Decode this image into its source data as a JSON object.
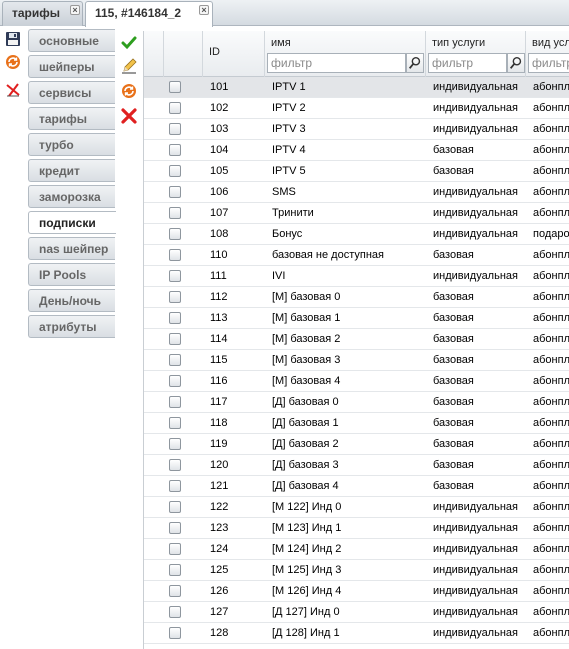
{
  "tabs": [
    {
      "label": "тарифы"
    },
    {
      "label": "115, #146184_2"
    }
  ],
  "subtabs": [
    {
      "label": "основные"
    },
    {
      "label": "шейперы"
    },
    {
      "label": "сервисы"
    },
    {
      "label": "тарифы"
    },
    {
      "label": "турбо"
    },
    {
      "label": "кредит"
    },
    {
      "label": "заморозка"
    },
    {
      "label": "подписки"
    },
    {
      "label": "nas шейпер"
    },
    {
      "label": "IP Pools"
    },
    {
      "label": "День/ночь"
    },
    {
      "label": "атрибуты"
    }
  ],
  "active_subtab": "подписки",
  "grid": {
    "columns": {
      "id": "ID",
      "name": "имя",
      "type": "тип услуги",
      "kind": "вид услу"
    },
    "filter_placeholder": "фильтр",
    "rows": [
      {
        "id": "101",
        "name": "IPTV 1",
        "type": "индивидуальная",
        "kind": "абонпл"
      },
      {
        "id": "102",
        "name": "IPTV 2",
        "type": "индивидуальная",
        "kind": "абонпл"
      },
      {
        "id": "103",
        "name": "IPTV 3",
        "type": "индивидуальная",
        "kind": "абонпл"
      },
      {
        "id": "104",
        "name": "IPTV 4",
        "type": "базовая",
        "kind": "абонпл"
      },
      {
        "id": "105",
        "name": "IPTV 5",
        "type": "базовая",
        "kind": "абонпл"
      },
      {
        "id": "106",
        "name": "SMS",
        "type": "индивидуальная",
        "kind": "абонпл"
      },
      {
        "id": "107",
        "name": "Тринити",
        "type": "индивидуальная",
        "kind": "абонпл"
      },
      {
        "id": "108",
        "name": "Бонус",
        "type": "индивидуальная",
        "kind": "подаро"
      },
      {
        "id": "110",
        "name": "базовая не доступная",
        "type": "базовая",
        "kind": "абонпл"
      },
      {
        "id": "111",
        "name": "IVI",
        "type": "индивидуальная",
        "kind": "абонпл"
      },
      {
        "id": "112",
        "name": "[M] базовая 0",
        "type": "базовая",
        "kind": "абонпл"
      },
      {
        "id": "113",
        "name": "[M] базовая 1",
        "type": "базовая",
        "kind": "абонпл"
      },
      {
        "id": "114",
        "name": "[M] базовая 2",
        "type": "базовая",
        "kind": "абонпл"
      },
      {
        "id": "115",
        "name": "[M] базовая 3",
        "type": "базовая",
        "kind": "абонпл"
      },
      {
        "id": "116",
        "name": "[M] базовая 4",
        "type": "базовая",
        "kind": "абонпл"
      },
      {
        "id": "117",
        "name": "[Д] базовая 0",
        "type": "базовая",
        "kind": "абонпл"
      },
      {
        "id": "118",
        "name": "[Д] базовая 1",
        "type": "базовая",
        "kind": "абонпл"
      },
      {
        "id": "119",
        "name": "[Д] базовая 2",
        "type": "базовая",
        "kind": "абонпл"
      },
      {
        "id": "120",
        "name": "[Д] базовая 3",
        "type": "базовая",
        "kind": "абонпл"
      },
      {
        "id": "121",
        "name": "[Д] базовая 4",
        "type": "базовая",
        "kind": "абонпл"
      },
      {
        "id": "122",
        "name": "[M 122] Инд 0",
        "type": "индивидуальная",
        "kind": "абонпл"
      },
      {
        "id": "123",
        "name": "[M 123] Инд 1",
        "type": "индивидуальная",
        "kind": "абонпл"
      },
      {
        "id": "124",
        "name": "[M 124] Инд 2",
        "type": "индивидуальная",
        "kind": "абонпл"
      },
      {
        "id": "125",
        "name": "[M 125] Инд 3",
        "type": "индивидуальная",
        "kind": "абонпл"
      },
      {
        "id": "126",
        "name": "[M 126] Инд 4",
        "type": "индивидуальная",
        "kind": "абонпл"
      },
      {
        "id": "127",
        "name": "[Д 127] Инд 0",
        "type": "индивидуальная",
        "kind": "абонпл"
      },
      {
        "id": "128",
        "name": "[Д 128] Инд 1",
        "type": "индивидуальная",
        "kind": "абонпл"
      }
    ]
  },
  "icons": {
    "left": [
      "save-icon",
      "refresh-icon",
      "cancel-icon"
    ],
    "actions": [
      "apply-icon",
      "edit-icon",
      "reload-icon",
      "delete-icon"
    ],
    "tab_close": "close-icon",
    "filter": "search-icon"
  },
  "colors": {
    "selected_row": "#e3e5e8",
    "check_green": "#2e9e1f",
    "delete_red": "#e02020",
    "refresh_orange": "#e8711a"
  }
}
